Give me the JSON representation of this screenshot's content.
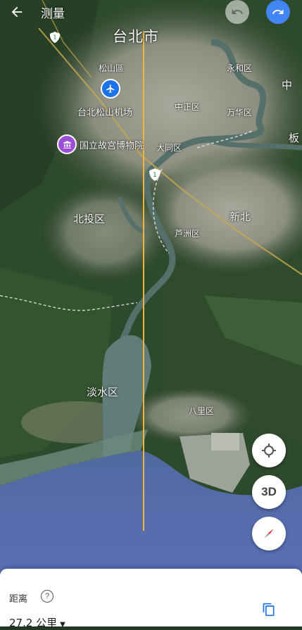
{
  "header": {
    "title": "测量"
  },
  "map_labels": {
    "taipei": "台北市",
    "songshan_old": "松山區",
    "yonghe": "永和区",
    "zhong_edge": "中",
    "airport": "台北松山机场",
    "zhongzheng": "中正区",
    "wanhua": "万华区",
    "museum": "国立故宫博物院",
    "datong": "大同区",
    "ban_edge": "板",
    "beitou": "北投区",
    "xinbei": "新北",
    "luzhou": "芦洲区",
    "danshui": "淡水区",
    "bali": "八里区"
  },
  "highway_shield": "1",
  "controls": {
    "three_d_label": "3D"
  },
  "measurement": {
    "label": "距离",
    "help_symbol": "?",
    "value": "27.2 公里"
  },
  "colors": {
    "measure_line": "#f2b53a",
    "accent": "#4285f4",
    "sea": "#5f6fb4",
    "compass_red": "#e53935"
  },
  "icons": [
    "back-arrow-icon",
    "undo-icon",
    "redo-icon",
    "airport-icon",
    "museum-icon",
    "highway-shield-icon",
    "my-location-icon",
    "compass-icon",
    "help-icon",
    "copy-icon",
    "dropdown-caret-icon"
  ]
}
